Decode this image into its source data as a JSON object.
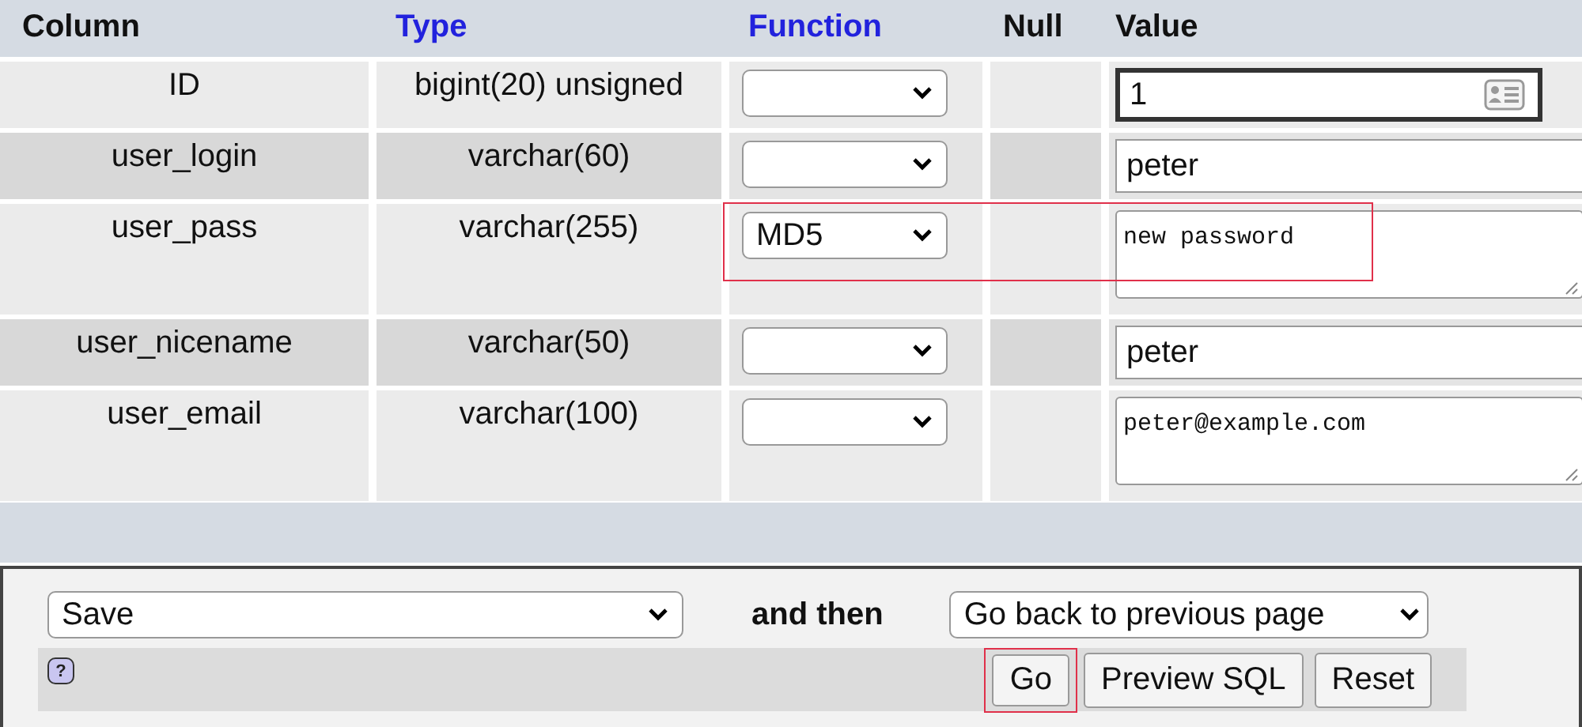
{
  "table": {
    "columns": [
      {
        "label": "Column",
        "sortable": false
      },
      {
        "label": "Type",
        "sortable": true
      },
      {
        "label": "Function",
        "sortable": true
      },
      {
        "label": "Null",
        "sortable": false
      },
      {
        "label": "Value",
        "sortable": false
      }
    ],
    "rows": [
      {
        "column": "ID",
        "type": "bigint(20) unsigned",
        "function": "",
        "value": "1",
        "kind": "input",
        "focused": true,
        "highlighted": false
      },
      {
        "column": "user_login",
        "type": "varchar(60)",
        "function": "",
        "value": "peter",
        "kind": "input",
        "focused": false,
        "highlighted": false
      },
      {
        "column": "user_pass",
        "type": "varchar(255)",
        "function": "MD5",
        "value": "new password",
        "kind": "textarea",
        "focused": false,
        "highlighted": true
      },
      {
        "column": "user_nicename",
        "type": "varchar(50)",
        "function": "",
        "value": "peter",
        "kind": "input",
        "focused": false,
        "highlighted": false
      },
      {
        "column": "user_email",
        "type": "varchar(100)",
        "function": "",
        "value": "peter@example.com",
        "kind": "textarea",
        "focused": false,
        "highlighted": false
      }
    ]
  },
  "footer": {
    "help": "?",
    "action": "Save",
    "and_then_label": "and then",
    "after": "Go back to previous page",
    "buttons": [
      {
        "label": "Go",
        "highlighted": true
      },
      {
        "label": "Preview SQL",
        "highlighted": false
      },
      {
        "label": "Reset",
        "highlighted": false
      }
    ]
  }
}
